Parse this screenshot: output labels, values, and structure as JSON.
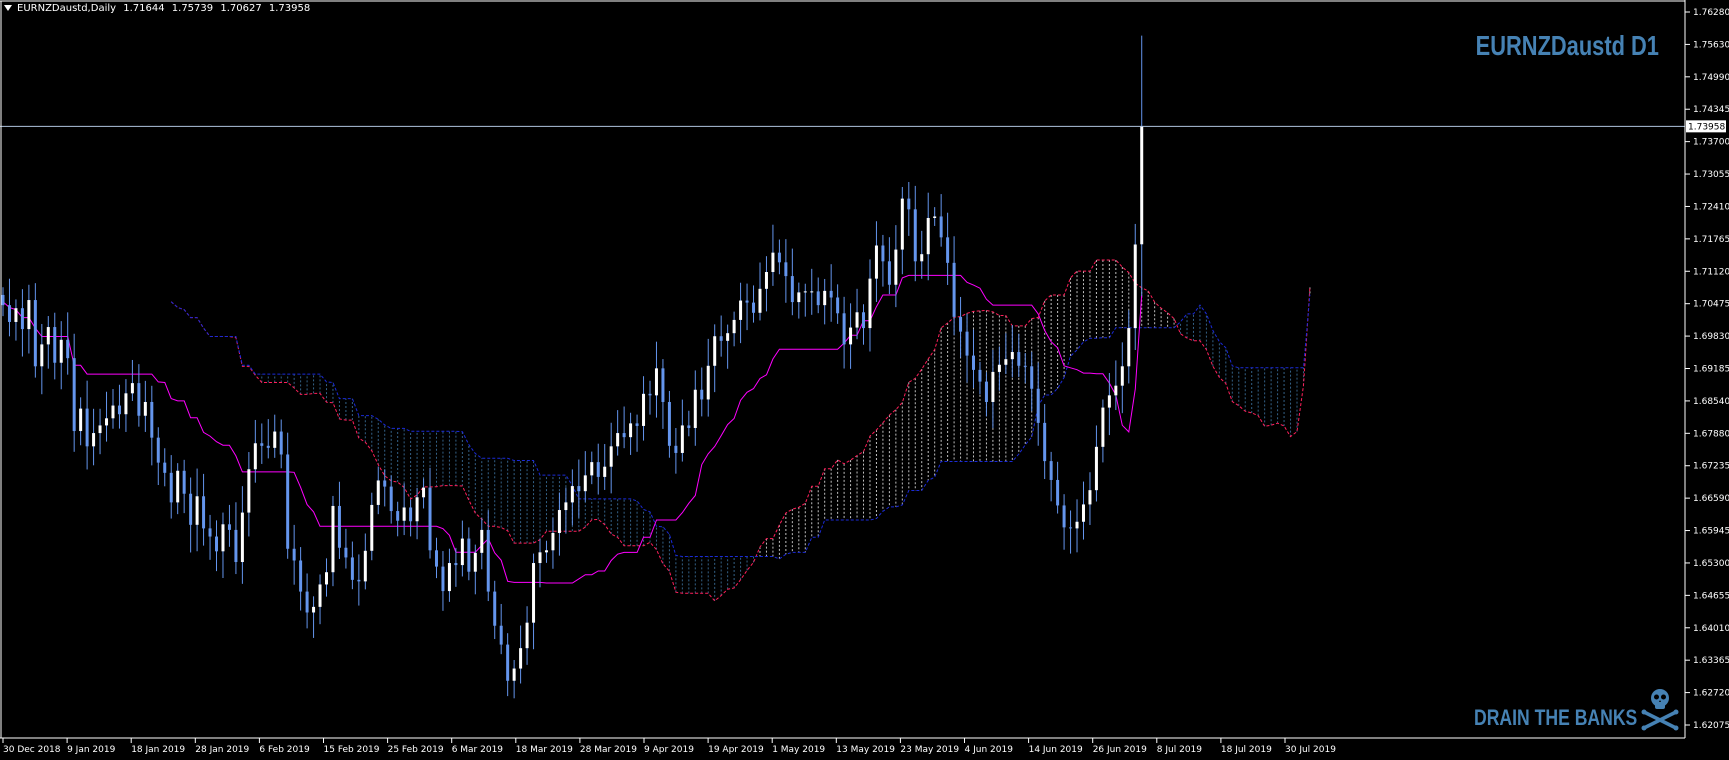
{
  "header": {
    "symbol": "EURNZDaustd,Daily",
    "open": "1.71644",
    "high": "1.75739",
    "low": "1.70627",
    "close": "1.73958"
  },
  "watermark": "EURNZDaustd D1",
  "slogan": "DRAIN THE BANKS",
  "current_price_label": "1.73958",
  "colors": {
    "background": "#000000",
    "axis": "#ffffff",
    "bull_candle": "#ffffff",
    "bear_candle": "#6495ED",
    "kijun_line": "#ff00ff",
    "cloud_bull": "#ff1f5a",
    "cloud_bear": "#1a2ad8",
    "cloud_fill_bull": "#ffffff",
    "cloud_fill_bear": "#4682B4",
    "watermark": "#4682B4"
  },
  "chart_data": {
    "type": "candlestick",
    "indicator": "Ichimoku Kinko Hyo",
    "ylim": [
      1.62075,
      1.7628
    ],
    "y_ticks": [
      "1.76280",
      "1.75630",
      "1.74990",
      "1.74345",
      "1.73700",
      "1.73055",
      "1.72410",
      "1.71765",
      "1.71120",
      "1.70475",
      "1.69830",
      "1.69185",
      "1.68540",
      "1.67880",
      "1.67235",
      "1.66590",
      "1.65945",
      "1.65300",
      "1.64655",
      "1.64010",
      "1.63365",
      "1.62720",
      "1.62075"
    ],
    "x_ticks": [
      "30 Dec 2018",
      "9 Jan 2019",
      "18 Jan 2019",
      "28 Jan 2019",
      "6 Feb 2019",
      "15 Feb 2019",
      "25 Feb 2019",
      "6 Mar 2019",
      "18 Mar 2019",
      "28 Mar 2019",
      "9 Apr 2019",
      "19 Apr 2019",
      "1 May 2019",
      "13 May 2019",
      "23 May 2019",
      "4 Jun 2019",
      "14 Jun 2019",
      "26 Jun 2019",
      "8 Jul 2019",
      "18 Jul 2019",
      "30 Jul 2019"
    ],
    "current_price": 1.73958,
    "closes": [
      1.7045,
      1.7012,
      1.7039,
      1.6998,
      1.7055,
      1.6925,
      1.6968,
      1.7002,
      1.6932,
      1.6977,
      1.6941,
      1.6798,
      1.6842,
      1.6768,
      1.6794,
      1.6809,
      1.6823,
      1.6848,
      1.6831,
      1.6872,
      1.6892,
      1.6828,
      1.6855,
      1.6785,
      1.6736,
      1.6716,
      1.6658,
      1.672,
      1.6675,
      1.6614,
      1.667,
      1.6607,
      1.6591,
      1.6562,
      1.6615,
      1.6604,
      1.6541,
      1.6638,
      1.6723,
      1.6774,
      1.6769,
      1.6765,
      1.6797,
      1.6752,
      1.6567,
      1.6544,
      1.6483,
      1.6442,
      1.6453,
      1.6497,
      1.6521,
      1.6651,
      1.6569,
      1.655,
      1.6506,
      1.6503,
      1.6563,
      1.6653,
      1.6701,
      1.6689,
      1.6641,
      1.6622,
      1.6648,
      1.6621,
      1.6668,
      1.6687,
      1.6564,
      1.6532,
      1.6484,
      1.6539,
      1.6535,
      1.6587,
      1.6522,
      1.6559,
      1.6604,
      1.6483,
      1.6416,
      1.6379,
      1.6308,
      1.6332,
      1.6372,
      1.6422,
      1.6539,
      1.656,
      1.6564,
      1.6598,
      1.6643,
      1.6658,
      1.669,
      1.668,
      1.6711,
      1.6737,
      1.6708,
      1.6728,
      1.6768,
      1.6794,
      1.6786,
      1.6813,
      1.6808,
      1.6871,
      1.6868,
      1.6921,
      1.6855,
      1.6769,
      1.6755,
      1.6809,
      1.6804,
      1.6879,
      1.686,
      1.6926,
      1.6984,
      1.6975,
      1.699,
      1.7016,
      1.7054,
      1.705,
      1.703,
      1.7077,
      1.711,
      1.7148,
      1.7129,
      1.7102,
      1.7051,
      1.707,
      1.7072,
      1.7072,
      1.7045,
      1.7073,
      1.706,
      1.7029,
      1.6968,
      1.7001,
      1.7031,
      1.7,
      1.7097,
      1.7162,
      1.7131,
      1.7085,
      1.7154,
      1.7254,
      1.7233,
      1.7131,
      1.7145,
      1.7216,
      1.7219,
      1.7178,
      1.7128,
      1.7022,
      1.6993,
      1.6946,
      1.6918,
      1.6895,
      1.6855,
      1.6914,
      1.6928,
      1.6939,
      1.6953,
      1.6926,
      1.6925,
      1.6881,
      1.6814,
      1.6739,
      1.6702,
      1.6652,
      1.6609,
      1.6607,
      1.662,
      1.6654,
      1.6682,
      1.6767,
      1.6844,
      1.6868,
      1.6887,
      1.6925,
      1.7,
      1.7164,
      1.7396
    ]
  }
}
